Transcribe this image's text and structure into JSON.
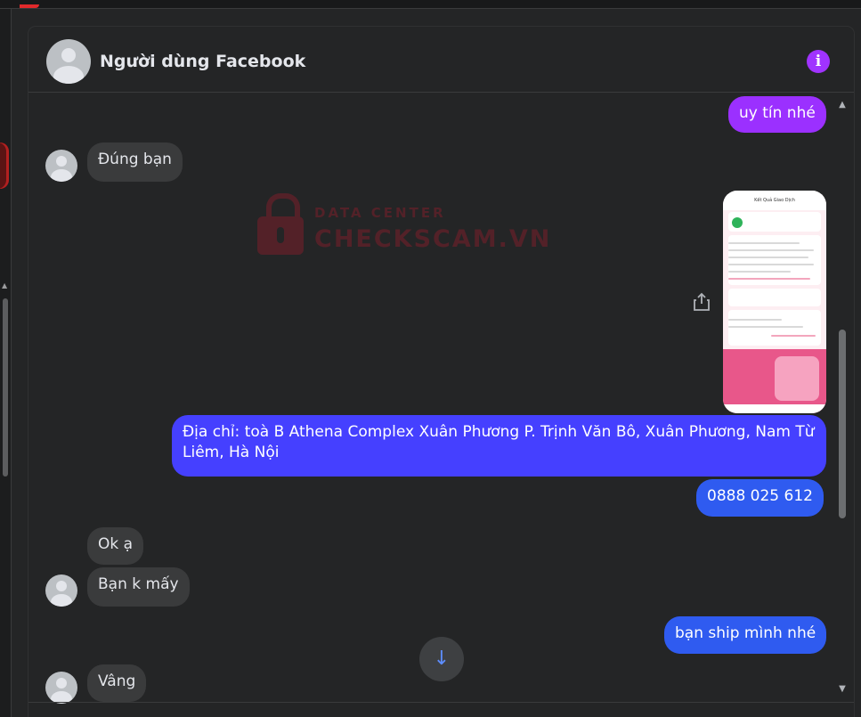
{
  "header": {
    "contact_name": "Người dùng Facebook",
    "info_icon": "info-icon",
    "info_glyph": "i"
  },
  "messages": [
    {
      "id": 1,
      "direction": "outgoing",
      "text": "uy tín nhé",
      "color": "#9b30ff"
    },
    {
      "id": 2,
      "direction": "incoming",
      "text": "Đúng bạn"
    },
    {
      "id": 3,
      "direction": "outgoing",
      "type": "image",
      "caption": "Kết Quả Giao Dịch"
    },
    {
      "id": 4,
      "direction": "outgoing",
      "text": "Địa chỉ: toà B Athena Complex Xuân Phương P. Trịnh Văn Bô, Xuân Phương, Nam Từ Liêm, Hà Nội",
      "color": "#4540ff"
    },
    {
      "id": 5,
      "direction": "outgoing",
      "text": "0888 025 612",
      "color": "#2f5bf0"
    },
    {
      "id": 6,
      "direction": "incoming",
      "text": "Ok ạ"
    },
    {
      "id": 7,
      "direction": "incoming",
      "text": "Bạn k mấy"
    },
    {
      "id": 8,
      "direction": "outgoing",
      "text": "bạn ship mình nhé",
      "color": "#2f5bf0"
    },
    {
      "id": 9,
      "direction": "incoming",
      "text": "Vâng"
    }
  ],
  "image_text": {
    "title": "Kết Quả Giao Dịch",
    "amount": "100.000đ",
    "receiver": "CAO VAN DUC",
    "bank": "MBBank"
  },
  "watermark": {
    "line1": "DATA CENTER",
    "line2": "CHECKSCAM.VN"
  },
  "controls": {
    "scroll_down_glyph": "↓",
    "scroll_up_arrow": "▲",
    "scroll_down_arrow": "▼"
  },
  "colors": {
    "background": "#242526",
    "incoming_bubble": "#3a3b3c",
    "accent_purple": "#a033ff"
  }
}
